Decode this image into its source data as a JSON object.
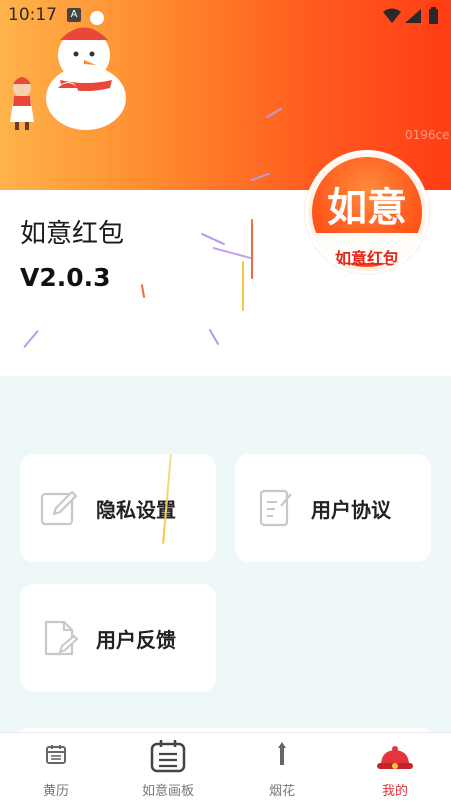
{
  "status_bar": {
    "time": "10:17",
    "notification_badge": "A"
  },
  "hero": {
    "watermark": "0196ce"
  },
  "app_info": {
    "name": "如意红包",
    "version": "V2.0.3"
  },
  "logo": {
    "big_text": "如意",
    "small_text": "如意红包"
  },
  "menu": [
    {
      "id": "privacy",
      "label": "隐私设置",
      "icon": "edit-icon"
    },
    {
      "id": "agreement",
      "label": "用户协议",
      "icon": "document-edit-icon"
    },
    {
      "id": "feedback",
      "label": "用户反馈",
      "icon": "file-edit-icon"
    }
  ],
  "tabbar": {
    "active": "我的",
    "tabs": [
      {
        "label": "黄历",
        "icon": "calendar-icon"
      },
      {
        "label": "如意画板",
        "icon": "board-icon"
      },
      {
        "label": "烟花",
        "icon": "firework-icon"
      },
      {
        "label": "我的",
        "icon": "profile-hat-icon"
      }
    ]
  },
  "colors": {
    "hero_start": "#ffb34a",
    "hero_end": "#ff3d16",
    "content_bg": "#eef8f8",
    "active_tab": "#e4343c"
  }
}
